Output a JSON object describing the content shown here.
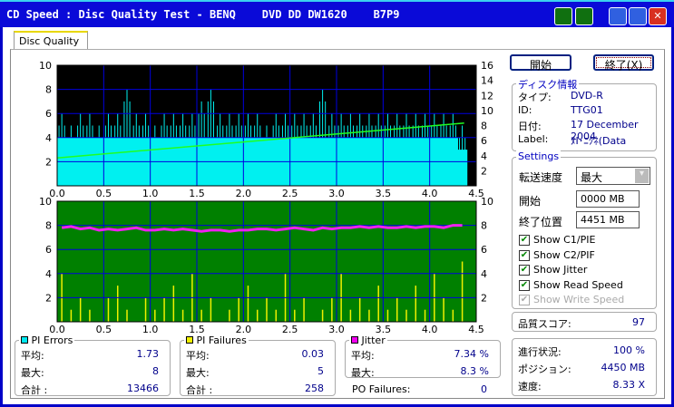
{
  "window": {
    "title": "CD Speed : Disc Quality Test - BENQ    DVD DD DW1620    B7P9"
  },
  "tab": {
    "label": "Disc Quality"
  },
  "buttons": {
    "start": "開始",
    "exit": "終了(X)"
  },
  "disc_info": {
    "title": "ディスク情報",
    "rows": [
      {
        "label": "タイプ:",
        "value": "DVD-R"
      },
      {
        "label": "ID:",
        "value": "TTG01"
      },
      {
        "label": "日付:",
        "value": "17 December 2004"
      },
      {
        "label": "Label:",
        "value": "ﾇI･ﾆｸﾈ(Data"
      }
    ]
  },
  "settings": {
    "title": "Settings",
    "speed_label": "転送速度",
    "speed_value": "最大",
    "start_label": "開始",
    "start_value": "0000 MB",
    "end_label": "終了位置",
    "end_value": "4451 MB",
    "checks": [
      {
        "label": "Show C1/PIE",
        "checked": true,
        "enabled": true
      },
      {
        "label": "Show C2/PIF",
        "checked": true,
        "enabled": true
      },
      {
        "label": "Show Jitter",
        "checked": true,
        "enabled": true
      },
      {
        "label": "Show Read Speed",
        "checked": true,
        "enabled": true
      },
      {
        "label": "Show Write Speed",
        "checked": true,
        "enabled": false
      }
    ]
  },
  "quality": {
    "label": "品質スコア:",
    "value": "97"
  },
  "progress": {
    "rows": [
      {
        "label": "進行状況:",
        "value": "100 %"
      },
      {
        "label": "ポジション:",
        "value": "4450 MB"
      },
      {
        "label": "速度:",
        "value": "8.33 X"
      }
    ]
  },
  "stats": {
    "pi_errors": {
      "title": "PI Errors",
      "color": "#00e8f0",
      "rows": [
        {
          "label": "平均:",
          "value": "1.73"
        },
        {
          "label": "最大:",
          "value": "8"
        },
        {
          "label": "合計 :",
          "value": "13466"
        }
      ]
    },
    "pi_failures": {
      "title": "PI Failures",
      "color": "#f0f000",
      "rows": [
        {
          "label": "平均:",
          "value": "0.03"
        },
        {
          "label": "最大:",
          "value": "5"
        },
        {
          "label": "合計 :",
          "value": "258"
        }
      ]
    },
    "jitter": {
      "title": "Jitter",
      "color": "#f000f0",
      "rows": [
        {
          "label": "平均:",
          "value": "7.34 %"
        },
        {
          "label": "最大:",
          "value": "8.3 %"
        }
      ]
    },
    "po_failures": {
      "label": "PO Failures:",
      "value": "0"
    }
  },
  "chart_data": [
    {
      "type": "bar",
      "title": "PI Errors / Read Speed",
      "x_ticks": [
        "0.0",
        "0.5",
        "1.0",
        "1.5",
        "2.0",
        "2.5",
        "3.0",
        "3.5",
        "4.0",
        "4.5"
      ],
      "xlim": [
        0,
        4.5
      ],
      "y_left_ticks": [
        "2",
        "4",
        "6",
        "8",
        "10"
      ],
      "ylim_left": [
        0,
        10
      ],
      "y_right_ticks": [
        "2",
        "4",
        "6",
        "8",
        "10",
        "12",
        "14",
        "16"
      ],
      "ylim_right": [
        0,
        16
      ],
      "bin_size_gb": 0.1,
      "data_end_gb": 4.37,
      "pie_avg": [
        4,
        4,
        4,
        4,
        4,
        4,
        4,
        4,
        4,
        4,
        4,
        4,
        4,
        4,
        4,
        4,
        4,
        4,
        4,
        4,
        4,
        4,
        4,
        4,
        4,
        4,
        4,
        4,
        4,
        4,
        4,
        4,
        4,
        4,
        4,
        4,
        4,
        4,
        4,
        4,
        4,
        4,
        4,
        3
      ],
      "pie_max": [
        6,
        5,
        6,
        6,
        5,
        6,
        6,
        8,
        6,
        6,
        5,
        6,
        6,
        6,
        6,
        7,
        8,
        6,
        6,
        6,
        6,
        6,
        5,
        6,
        6,
        6,
        6,
        6,
        8,
        6,
        6,
        6,
        6,
        6,
        6,
        6,
        6,
        6,
        6,
        6,
        6,
        6,
        6,
        5
      ],
      "read_speed_x": {
        "start": 3.7,
        "end": 8.33
      }
    },
    {
      "type": "bar",
      "title": "PI Failures / Jitter",
      "x_ticks": [
        "0.0",
        "0.5",
        "1.0",
        "1.5",
        "2.0",
        "2.5",
        "3.0",
        "3.5",
        "4.0",
        "4.5"
      ],
      "xlim": [
        0,
        4.5
      ],
      "y_left_ticks": [
        "2",
        "4",
        "6",
        "8",
        "10"
      ],
      "ylim_left": [
        0,
        10
      ],
      "y_right_ticks": [
        "2",
        "4",
        "6",
        "8",
        "10"
      ],
      "ylim_right": [
        0,
        10
      ],
      "bin_size_gb": 0.1,
      "pif_max": [
        4,
        1,
        2,
        1,
        0,
        2,
        3,
        1,
        0,
        2,
        1,
        2,
        3,
        1,
        4,
        1,
        2,
        0,
        1,
        2,
        3,
        1,
        2,
        1,
        4,
        1,
        2,
        0,
        1,
        2,
        4,
        1,
        2,
        1,
        3,
        1,
        2,
        1,
        3,
        1,
        4,
        2,
        1,
        5
      ],
      "jitter_pct": [
        7.8,
        7.9,
        7.7,
        7.8,
        7.6,
        7.7,
        7.6,
        7.7,
        7.8,
        7.6,
        7.6,
        7.7,
        7.6,
        7.7,
        7.6,
        7.5,
        7.6,
        7.6,
        7.5,
        7.6,
        7.6,
        7.7,
        7.7,
        7.6,
        7.7,
        7.8,
        7.7,
        7.6,
        7.8,
        7.7,
        7.8,
        7.8,
        7.9,
        7.8,
        7.9,
        7.8,
        7.8,
        7.9,
        7.8,
        7.9,
        7.9,
        7.8,
        8.0,
        8.0
      ]
    }
  ]
}
